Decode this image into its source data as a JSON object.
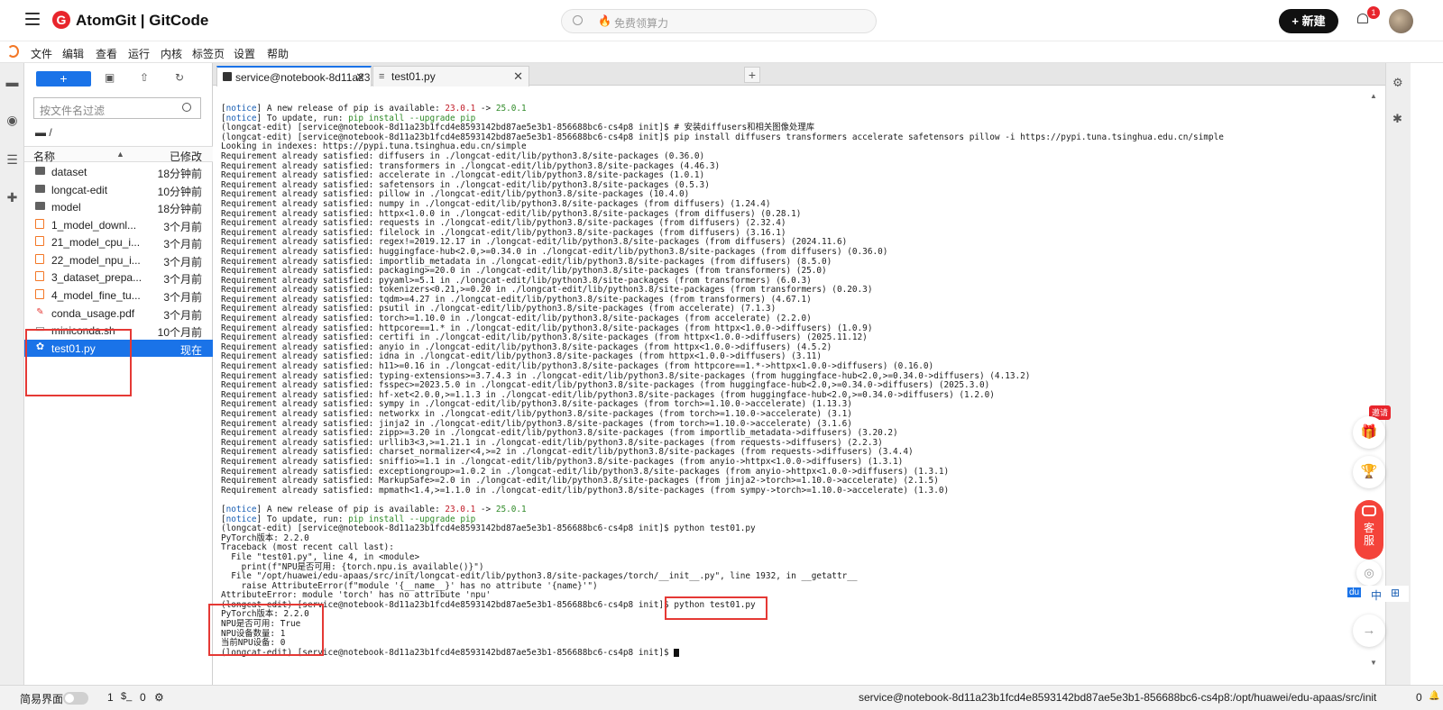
{
  "topbar": {
    "logo_letter": "G",
    "logo_text": "AtomGit | GitCode",
    "search_placeholder": "免费领算力",
    "new_button": "+ 新建",
    "notification_count": "1"
  },
  "menu": [
    "文件",
    "编辑",
    "查看",
    "运行",
    "内核",
    "标签页",
    "设置",
    "帮助"
  ],
  "filebrowser": {
    "add_label": "+",
    "filter_placeholder": "按文件名过滤",
    "breadcrumb": "/",
    "col_name": "名称",
    "col_modified": "已修改",
    "files": [
      {
        "name": "dataset",
        "modified": "18分钟前",
        "type": "folder"
      },
      {
        "name": "longcat-edit",
        "modified": "10分钟前",
        "type": "folder"
      },
      {
        "name": "model",
        "modified": "18分钟前",
        "type": "folder"
      },
      {
        "name": "1_model_downl...",
        "modified": "3个月前",
        "type": "notebook"
      },
      {
        "name": "21_model_cpu_i...",
        "modified": "3个月前",
        "type": "notebook"
      },
      {
        "name": "22_model_npu_i...",
        "modified": "3个月前",
        "type": "notebook"
      },
      {
        "name": "3_dataset_prepa...",
        "modified": "3个月前",
        "type": "notebook"
      },
      {
        "name": "4_model_fine_tu...",
        "modified": "3个月前",
        "type": "notebook"
      },
      {
        "name": "conda_usage.pdf",
        "modified": "3个月前",
        "type": "pdf"
      },
      {
        "name": "miniconda.sh",
        "modified": "10个月前",
        "type": "file"
      },
      {
        "name": "test01.py",
        "modified": "现在",
        "type": "python"
      }
    ]
  },
  "tabs": [
    {
      "label": "service@notebook-8d11a23",
      "active": true
    },
    {
      "label": "test01.py",
      "active": false
    }
  ],
  "terminal": {
    "lines": [
      [
        {
          "t": "[",
          "c": ""
        },
        {
          "t": "notice",
          "c": "blue"
        },
        {
          "t": "] A new release of pip is available: ",
          "c": ""
        },
        {
          "t": "23.0.1",
          "c": "red"
        },
        {
          "t": " -> ",
          "c": ""
        },
        {
          "t": "25.0.1",
          "c": "grn"
        }
      ],
      [
        {
          "t": "[",
          "c": ""
        },
        {
          "t": "notice",
          "c": "blue"
        },
        {
          "t": "] To update, run: ",
          "c": ""
        },
        {
          "t": "pip install --upgrade pip",
          "c": "grn"
        }
      ],
      "(longcat-edit) [service@notebook-8d11a23b1fcd4e8593142bd87ae5e3b1-856688bc6-cs4p8 init]$ # 安装diffusers和相关图像处理库",
      "(longcat-edit) [service@notebook-8d11a23b1fcd4e8593142bd87ae5e3b1-856688bc6-cs4p8 init]$ pip install diffusers transformers accelerate safetensors pillow -i https://pypi.tuna.tsinghua.edu.cn/simple",
      "Looking in indexes: https://pypi.tuna.tsinghua.edu.cn/simple",
      "Requirement already satisfied: diffusers in ./longcat-edit/lib/python3.8/site-packages (0.36.0)",
      "Requirement already satisfied: transformers in ./longcat-edit/lib/python3.8/site-packages (4.46.3)",
      "Requirement already satisfied: accelerate in ./longcat-edit/lib/python3.8/site-packages (1.0.1)",
      "Requirement already satisfied: safetensors in ./longcat-edit/lib/python3.8/site-packages (0.5.3)",
      "Requirement already satisfied: pillow in ./longcat-edit/lib/python3.8/site-packages (10.4.0)",
      "Requirement already satisfied: numpy in ./longcat-edit/lib/python3.8/site-packages (from diffusers) (1.24.4)",
      "Requirement already satisfied: httpx<1.0.0 in ./longcat-edit/lib/python3.8/site-packages (from diffusers) (0.28.1)",
      "Requirement already satisfied: requests in ./longcat-edit/lib/python3.8/site-packages (from diffusers) (2.32.4)",
      "Requirement already satisfied: filelock in ./longcat-edit/lib/python3.8/site-packages (from diffusers) (3.16.1)",
      "Requirement already satisfied: regex!=2019.12.17 in ./longcat-edit/lib/python3.8/site-packages (from diffusers) (2024.11.6)",
      "Requirement already satisfied: huggingface-hub<2.0,>=0.34.0 in ./longcat-edit/lib/python3.8/site-packages (from diffusers) (0.36.0)",
      "Requirement already satisfied: importlib_metadata in ./longcat-edit/lib/python3.8/site-packages (from diffusers) (8.5.0)",
      "Requirement already satisfied: packaging>=20.0 in ./longcat-edit/lib/python3.8/site-packages (from transformers) (25.0)",
      "Requirement already satisfied: pyyaml>=5.1 in ./longcat-edit/lib/python3.8/site-packages (from transformers) (6.0.3)",
      "Requirement already satisfied: tokenizers<0.21,>=0.20 in ./longcat-edit/lib/python3.8/site-packages (from transformers) (0.20.3)",
      "Requirement already satisfied: tqdm>=4.27 in ./longcat-edit/lib/python3.8/site-packages (from transformers) (4.67.1)",
      "Requirement already satisfied: psutil in ./longcat-edit/lib/python3.8/site-packages (from accelerate) (7.1.3)",
      "Requirement already satisfied: torch>=1.10.0 in ./longcat-edit/lib/python3.8/site-packages (from accelerate) (2.2.0)",
      "Requirement already satisfied: httpcore==1.* in ./longcat-edit/lib/python3.8/site-packages (from httpx<1.0.0->diffusers) (1.0.9)",
      "Requirement already satisfied: certifi in ./longcat-edit/lib/python3.8/site-packages (from httpx<1.0.0->diffusers) (2025.11.12)",
      "Requirement already satisfied: anyio in ./longcat-edit/lib/python3.8/site-packages (from httpx<1.0.0->diffusers) (4.5.2)",
      "Requirement already satisfied: idna in ./longcat-edit/lib/python3.8/site-packages (from httpx<1.0.0->diffusers) (3.11)",
      "Requirement already satisfied: h11>=0.16 in ./longcat-edit/lib/python3.8/site-packages (from httpcore==1.*->httpx<1.0.0->diffusers) (0.16.0)",
      "Requirement already satisfied: typing-extensions>=3.7.4.3 in ./longcat-edit/lib/python3.8/site-packages (from huggingface-hub<2.0,>=0.34.0->diffusers) (4.13.2)",
      "Requirement already satisfied: fsspec>=2023.5.0 in ./longcat-edit/lib/python3.8/site-packages (from huggingface-hub<2.0,>=0.34.0->diffusers) (2025.3.0)",
      "Requirement already satisfied: hf-xet<2.0.0,>=1.1.3 in ./longcat-edit/lib/python3.8/site-packages (from huggingface-hub<2.0,>=0.34.0->diffusers) (1.2.0)",
      "Requirement already satisfied: sympy in ./longcat-edit/lib/python3.8/site-packages (from torch>=1.10.0->accelerate) (1.13.3)",
      "Requirement already satisfied: networkx in ./longcat-edit/lib/python3.8/site-packages (from torch>=1.10.0->accelerate) (3.1)",
      "Requirement already satisfied: jinja2 in ./longcat-edit/lib/python3.8/site-packages (from torch>=1.10.0->accelerate) (3.1.6)",
      "Requirement already satisfied: zipp>=3.20 in ./longcat-edit/lib/python3.8/site-packages (from importlib_metadata->diffusers) (3.20.2)",
      "Requirement already satisfied: urllib3<3,>=1.21.1 in ./longcat-edit/lib/python3.8/site-packages (from requests->diffusers) (2.2.3)",
      "Requirement already satisfied: charset_normalizer<4,>=2 in ./longcat-edit/lib/python3.8/site-packages (from requests->diffusers) (3.4.4)",
      "Requirement already satisfied: sniffio>=1.1 in ./longcat-edit/lib/python3.8/site-packages (from anyio->httpx<1.0.0->diffusers) (1.3.1)",
      "Requirement already satisfied: exceptiongroup>=1.0.2 in ./longcat-edit/lib/python3.8/site-packages (from anyio->httpx<1.0.0->diffusers) (1.3.1)",
      "Requirement already satisfied: MarkupSafe>=2.0 in ./longcat-edit/lib/python3.8/site-packages (from jinja2->torch>=1.10.0->accelerate) (2.1.5)",
      "Requirement already satisfied: mpmath<1.4,>=1.1.0 in ./longcat-edit/lib/python3.8/site-packages (from sympy->torch>=1.10.0->accelerate) (1.3.0)",
      "",
      [
        {
          "t": "[",
          "c": ""
        },
        {
          "t": "notice",
          "c": "blue"
        },
        {
          "t": "] A new release of pip is available: ",
          "c": ""
        },
        {
          "t": "23.0.1",
          "c": "red"
        },
        {
          "t": " -> ",
          "c": ""
        },
        {
          "t": "25.0.1",
          "c": "grn"
        }
      ],
      [
        {
          "t": "[",
          "c": ""
        },
        {
          "t": "notice",
          "c": "blue"
        },
        {
          "t": "] To update, run: ",
          "c": ""
        },
        {
          "t": "pip install --upgrade pip",
          "c": "grn"
        }
      ],
      "(longcat-edit) [service@notebook-8d11a23b1fcd4e8593142bd87ae5e3b1-856688bc6-cs4p8 init]$ python test01.py",
      "PyTorch版本: 2.2.0",
      "Traceback (most recent call last):",
      "  File \"test01.py\", line 4, in <module>",
      "    print(f\"NPU是否可用: {torch.npu.is_available()}\")",
      "  File \"/opt/huawei/edu-apaas/src/init/longcat-edit/lib/python3.8/site-packages/torch/__init__.py\", line 1932, in __getattr__",
      "    raise AttributeError(f\"module '{__name__}' has no attribute '{name}'\")",
      "AttributeError: module 'torch' has no attribute 'npu'",
      "(longcat-edit) [service@notebook-8d11a23b1fcd4e8593142bd87ae5e3b1-856688bc6-cs4p8 init]$ python test01.py",
      "PyTorch版本: 2.2.0",
      "NPU是否可用: True",
      "NPU设备数量: 1",
      "当前NPU设备: 0",
      "(longcat-edit) [service@notebook-8d11a23b1fcd4e8593142bd87ae5e3b1-856688bc6-cs4p8 init]$ "
    ]
  },
  "float_buttons": {
    "invite": "邀请",
    "kefu_1": "客",
    "kefu_2": "服",
    "lang_zh": "中"
  },
  "status": {
    "simple_mode": "简易界面",
    "count_a": "1",
    "count_b": "0",
    "path": "service@notebook-8d11a23b1fcd4e8593142bd87ae5e3b1-856688bc6-cs4p8:/opt/huawei/edu-apaas/src/init",
    "right_count": "0"
  },
  "colors": {
    "accent": "#1a73e8",
    "brand": "#e8252c",
    "highlight_box": "#e53935"
  }
}
